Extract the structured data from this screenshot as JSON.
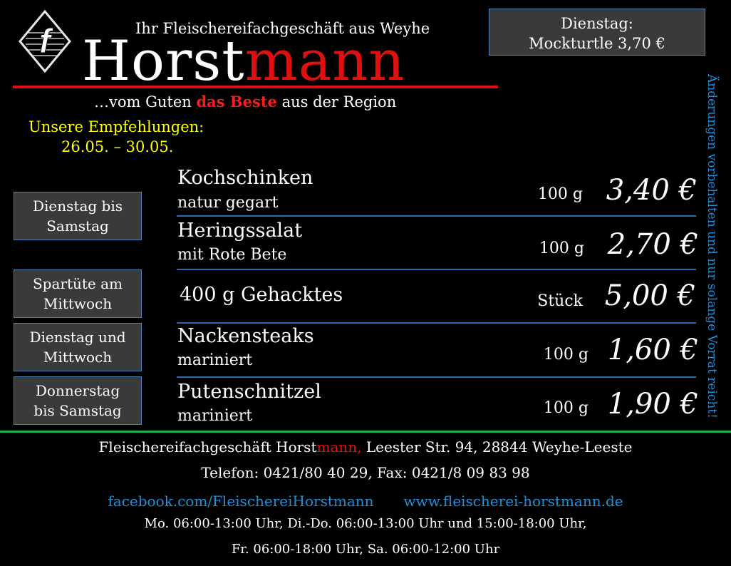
{
  "header": {
    "tagline": "Ihr Fleischereifachgeschäft aus Weyhe",
    "brand_part1": "Horst",
    "brand_part2": "mann",
    "logo_letter": "f",
    "slogan_pre": "…vom Guten ",
    "slogan_highlight": "das Beste",
    "slogan_post": " aus der Region"
  },
  "special": {
    "line1": "Dienstag:",
    "line2": "Mockturtle 3,70 €"
  },
  "recommendations": {
    "title": "Unsere Empfehlungen:",
    "dates": "26.05. – 30.05."
  },
  "notice": "Änderungen vorbehalten und nur solange Vorrat reicht!",
  "day_boxes": [
    {
      "line1": "Dienstag bis",
      "line2": "Samstag"
    },
    {
      "line1": "Spartüte am",
      "line2": "Mittwoch"
    },
    {
      "line1": "Dienstag und",
      "line2": "Mittwoch"
    },
    {
      "line1": "Donnerstag",
      "line2": "bis Samstag"
    }
  ],
  "products": [
    {
      "name": "Kochschinken",
      "sub": "natur gegart",
      "unit": "100 g",
      "price": "3,40 €"
    },
    {
      "name": "Heringssalat",
      "sub": "mit Rote Bete",
      "unit": "100 g",
      "price": "2,70 €"
    },
    {
      "name": "400 g Gehacktes",
      "sub": "",
      "unit": "Stück",
      "price": "5,00 €"
    },
    {
      "name": "Nackensteaks",
      "sub": "mariniert",
      "unit": "100 g",
      "price": "1,60 €"
    },
    {
      "name": "Putenschnitzel",
      "sub": "mariniert",
      "unit": "100 g",
      "price": "1,90 €"
    }
  ],
  "footer": {
    "address_pre": "Fleischereifachgeschäft Horst",
    "address_red": "mann,",
    "address_post": " Leester Str. 94, 28844 Weyhe-Leeste",
    "phone": "Telefon: 0421/80 40 29, Fax: 0421/8 09 83 98",
    "facebook": "facebook.com/FleischereiHorstmann",
    "website": "www.fleischerei-horstmann.de",
    "hours1": "Mo. 06:00-13:00 Uhr, Di.-Do. 06:00-13:00 Uhr und 15:00-18:00 Uhr,",
    "hours2": "Fr. 06:00-18:00 Uhr, Sa. 06:00-12:00 Uhr"
  },
  "colors": {
    "background": "#000000",
    "brand_red": "#e01010",
    "highlight_yellow": "#ffff00",
    "link_blue": "#1e90d8",
    "separator_blue": "#2a6bb8",
    "divider_green": "#1fb14a",
    "box_gray": "#3a3a3a"
  }
}
